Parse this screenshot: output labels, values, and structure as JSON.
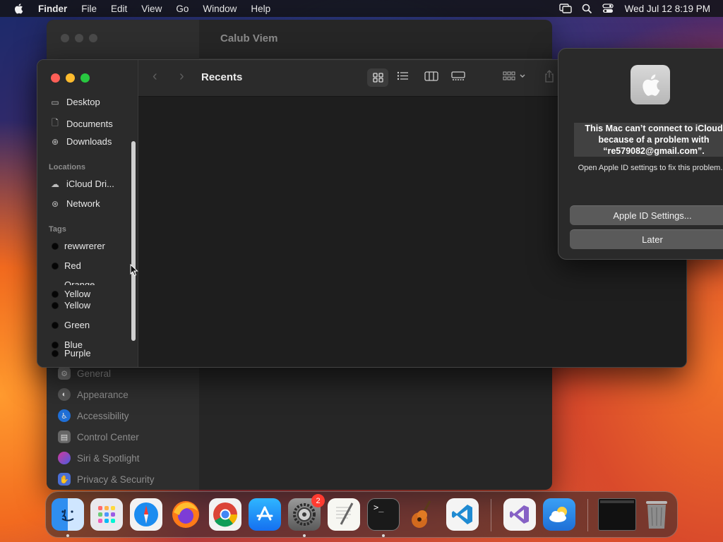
{
  "menubar": {
    "app_name": "Finder",
    "items": [
      "File",
      "Edit",
      "View",
      "Go",
      "Window",
      "Help"
    ],
    "clock": "Wed Jul 12  8:19 PM"
  },
  "settings_window": {
    "title": "Calub Viem",
    "items": [
      {
        "label": "General",
        "icon": "gear-icon",
        "color": "#7a7a7a"
      },
      {
        "label": "Appearance",
        "icon": "appearance-icon",
        "color": "#5a5a5a"
      },
      {
        "label": "Accessibility",
        "icon": "accessibility-icon",
        "color": "#1f6fd6"
      },
      {
        "label": "Control Center",
        "icon": "control-center-icon",
        "color": "#6a6a6a"
      },
      {
        "label": "Siri & Spotlight",
        "icon": "siri-icon",
        "color": "#b03a9c"
      },
      {
        "label": "Privacy & Security",
        "icon": "hand-icon",
        "color": "#4a6fd6"
      }
    ]
  },
  "finder": {
    "title": "Recents",
    "favorites": [
      {
        "label": "Desktop",
        "icon": "desktop-icon"
      },
      {
        "label": "Documents",
        "icon": "document-icon"
      },
      {
        "label": "Downloads",
        "icon": "download-icon"
      }
    ],
    "locations_header": "Locations",
    "locations": [
      {
        "label": "iCloud Dri...",
        "icon": "cloud-icon"
      },
      {
        "label": "Network",
        "icon": "globe-icon"
      }
    ],
    "tags_header": "Tags",
    "tags": [
      "rewwrerer",
      "Red",
      "Orange",
      "Yellow",
      "Yellow",
      "Green",
      "Blue",
      "Purple"
    ]
  },
  "alert": {
    "heading": "This Mac can’t connect to iCloud because of a problem with “re579082@gmail.com”.",
    "body": "Open Apple ID settings to fix this problem.",
    "primary_button": "Apple ID Settings...",
    "secondary_button": "Later"
  },
  "dock": {
    "apps": [
      {
        "name": "Finder",
        "icon": "finder-icon",
        "running": true
      },
      {
        "name": "Launchpad",
        "icon": "launchpad-icon",
        "running": false
      },
      {
        "name": "Safari",
        "icon": "safari-icon",
        "running": false
      },
      {
        "name": "Firefox",
        "icon": "firefox-icon",
        "running": false
      },
      {
        "name": "Chrome",
        "icon": "chrome-icon",
        "running": false
      },
      {
        "name": "App Store",
        "icon": "app-store-icon",
        "running": false
      },
      {
        "name": "System Settings",
        "icon": "system-settings-icon",
        "running": true,
        "badge": "2"
      },
      {
        "name": "TextEdit",
        "icon": "textedit-icon",
        "running": false
      },
      {
        "name": "Terminal",
        "icon": "terminal-icon",
        "running": true,
        "glyph": ">_"
      },
      {
        "name": "GarageBand",
        "icon": "garageband-icon",
        "running": false
      },
      {
        "name": "VS Code",
        "icon": "vscode-icon",
        "running": false
      },
      {
        "name": "Visual Studio",
        "icon": "visual-studio-icon",
        "running": false
      },
      {
        "name": "Weather",
        "icon": "weather-icon",
        "running": false
      },
      {
        "name": "Window Preview",
        "icon": "window-preview-icon",
        "running": false
      },
      {
        "name": "Trash",
        "icon": "trash-icon",
        "running": false
      }
    ]
  }
}
